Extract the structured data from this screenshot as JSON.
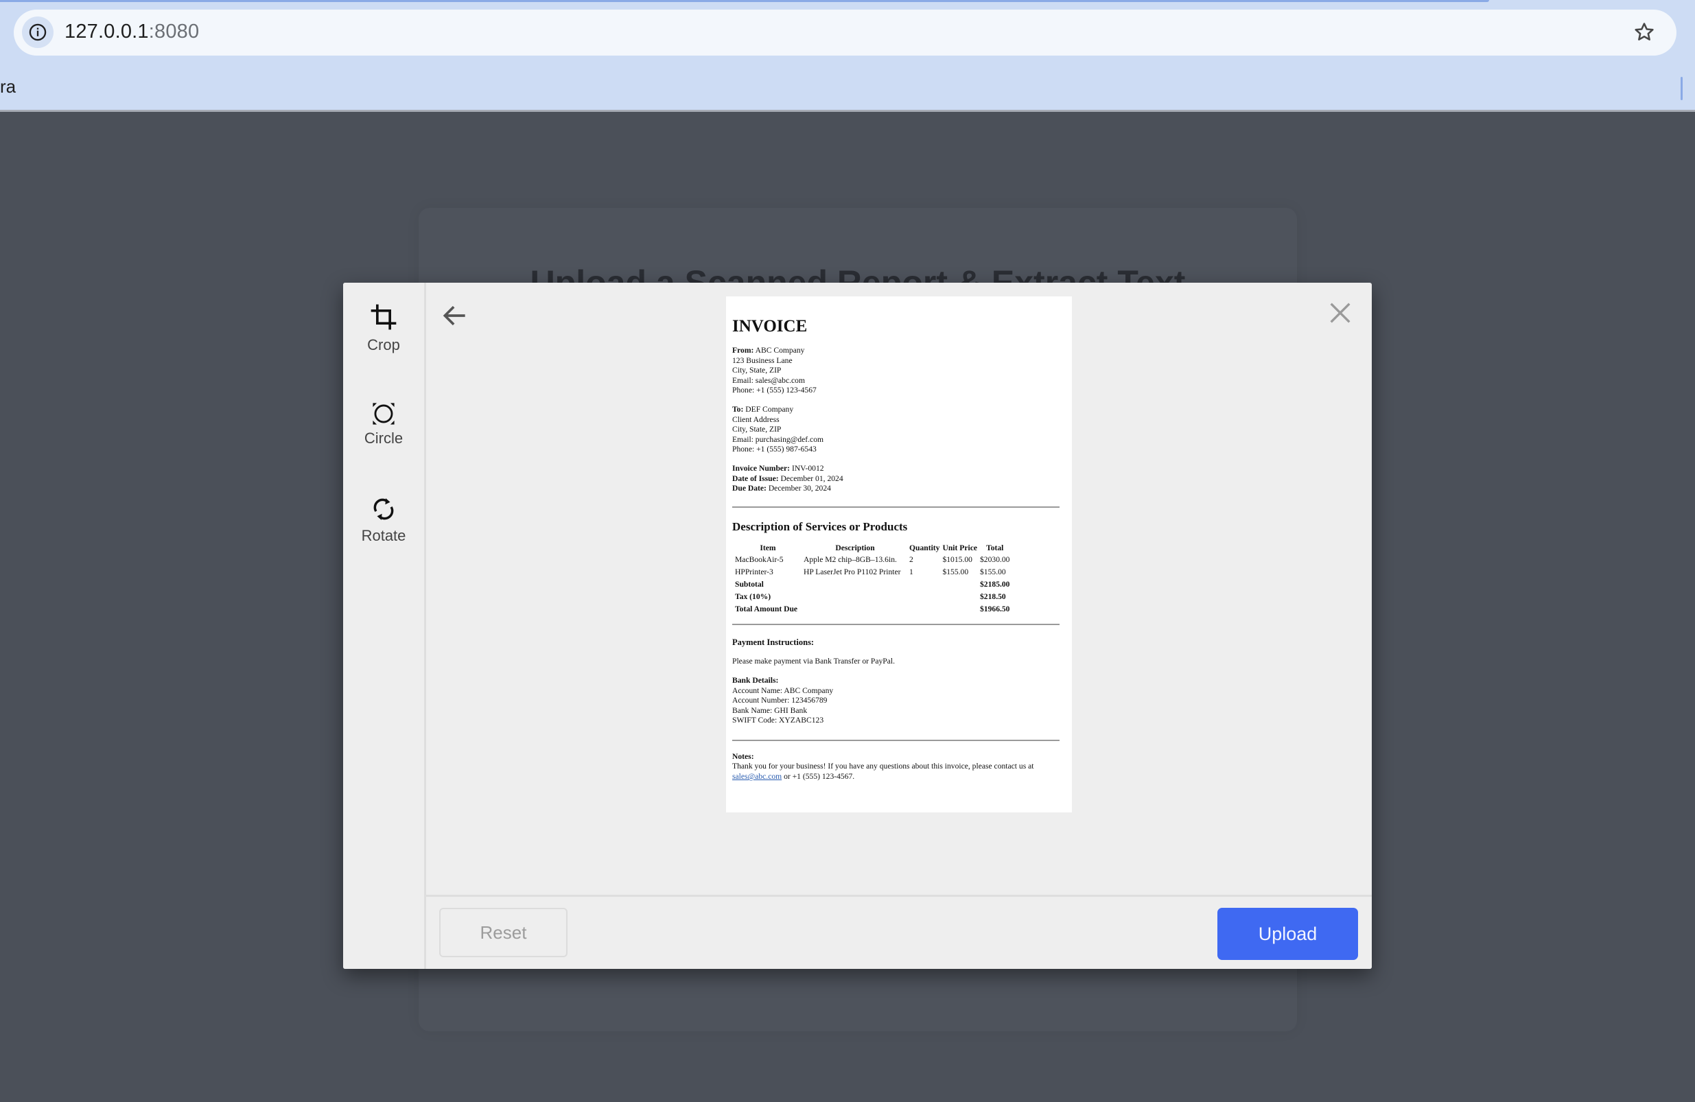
{
  "browser": {
    "url_host": "127.0.0.1",
    "url_port": ":8080",
    "bookmark_partial": "ra",
    "icons": {
      "site_info": "info-icon",
      "bookmark": "star-icon"
    }
  },
  "page": {
    "heading": "Upload a Scanned Report & Extract Text"
  },
  "modal": {
    "tools": [
      {
        "label": "Crop",
        "icon": "crop-icon"
      },
      {
        "label": "Circle",
        "icon": "circle-crop-icon"
      },
      {
        "label": "Rotate",
        "icon": "rotate-icon"
      }
    ],
    "back_icon": "arrow-left-icon",
    "close_icon": "close-icon",
    "reset_label": "Reset",
    "upload_label": "Upload",
    "colors": {
      "upload": "#3f69f2",
      "modal_bg": "#eeeeee",
      "overlay": "#4b5059"
    }
  },
  "document": {
    "title": "INVOICE",
    "from": {
      "label": "From:",
      "name": "ABC Company",
      "lines": [
        "123 Business Lane",
        "City, State, ZIP",
        "Email: sales@abc.com",
        "Phone: +1 (555) 123-4567"
      ]
    },
    "to": {
      "label": "To:",
      "name": "DEF Company",
      "lines": [
        "Client Address",
        "City, State, ZIP",
        "Email: purchasing@def.com",
        "Phone: +1 (555) 987-6543"
      ]
    },
    "meta": [
      {
        "label": "Invoice Number:",
        "value": "INV-0012"
      },
      {
        "label": "Date of Issue:",
        "value": "December 01, 2024"
      },
      {
        "label": "Due Date:",
        "value": "December 30, 2024"
      }
    ],
    "items_heading": "Description of Services or Products",
    "table": {
      "headers": [
        "Item",
        "Description",
        "Quantity",
        "Unit Price",
        "Total"
      ],
      "rows": [
        [
          "MacBookAir-5",
          "Apple M2 chip–8GB–13.6in.",
          "2",
          "$1015.00",
          "$2030.00"
        ],
        [
          "HPPrinter-3",
          "HP LaserJet Pro P1102 Printer",
          "1",
          "$155.00",
          "$155.00"
        ]
      ],
      "summary": [
        {
          "label": "Subtotal",
          "value": "$2185.00"
        },
        {
          "label": "Tax (10%)",
          "value": "$218.50"
        },
        {
          "label": "Total Amount Due",
          "value": "$1966.50"
        }
      ]
    },
    "payment_heading": "Payment Instructions:",
    "payment_text": "Please make payment via Bank Transfer or PayPal.",
    "bank_heading": "Bank Details:",
    "bank_lines": [
      "Account Name: ABC Company",
      "Account Number: 123456789",
      "Bank Name: GHI Bank",
      "SWIFT Code: XYZABC123"
    ],
    "notes_heading": "Notes:",
    "notes_text_1": "Thank you for your business! If you have any questions about this invoice, please contact us at ",
    "notes_link": "sales@abc.com",
    "notes_text_2": " or +1 (555) 123-4567."
  }
}
